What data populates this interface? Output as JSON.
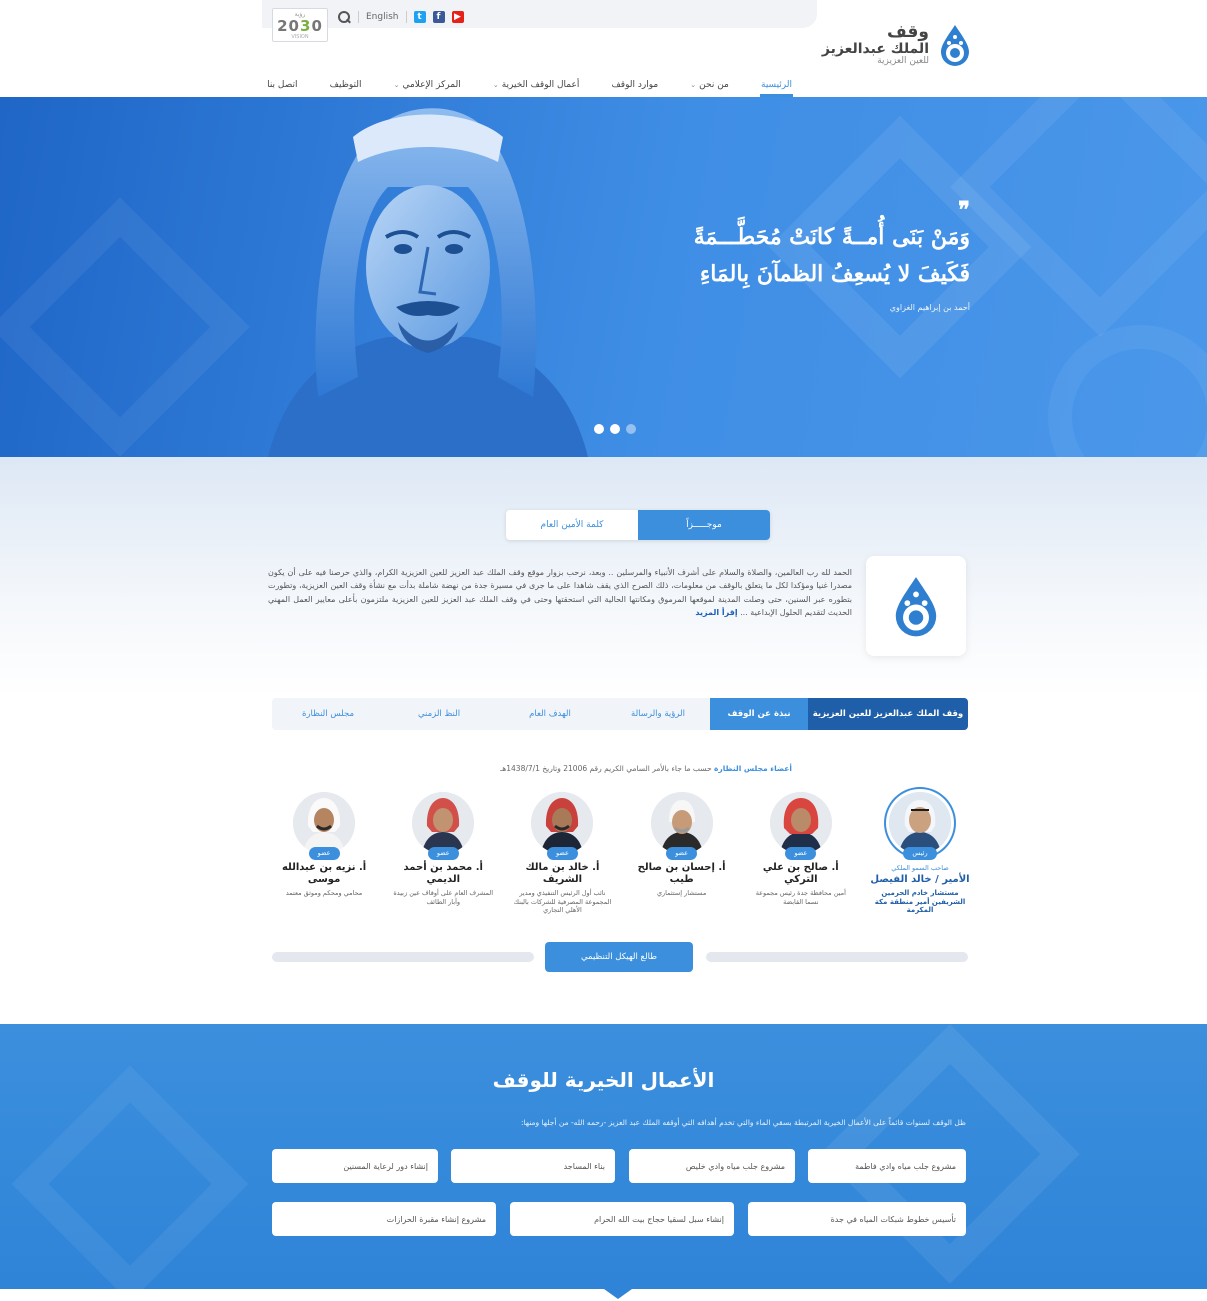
{
  "header": {
    "vision": {
      "top": "رؤية",
      "num_a": "20",
      "num_b": "3",
      "num_c": "0",
      "bottom": "VISION"
    },
    "language": "English",
    "brand": {
      "line1": "وقف",
      "line2": "الملك عبدالعزيز",
      "line3": "للعين العزيزية"
    },
    "nav": [
      {
        "label": "الرئيسية",
        "dropdown": false,
        "active": true
      },
      {
        "label": "من نحن",
        "dropdown": true,
        "active": false
      },
      {
        "label": "موارد الوقف",
        "dropdown": false,
        "active": false
      },
      {
        "label": "أعمال الوقف الخيرية",
        "dropdown": true,
        "active": false
      },
      {
        "label": "المركز الإعلامي",
        "dropdown": true,
        "active": false
      },
      {
        "label": "التوظيف",
        "dropdown": false,
        "active": false
      },
      {
        "label": "اتصل بنا",
        "dropdown": false,
        "active": false
      }
    ]
  },
  "hero": {
    "quote_mark": "❞",
    "line1": "وَمَنْ بَنَى أُمــةً كانَتْ مُحَطَّـــمَةً",
    "line2": "فَكَيفَ لا يُسعِفُ الظمآنَ بِالمَاءِ",
    "author": "أحمد بن إبراهيم الغزاوي",
    "slides": 3,
    "active_slide": 0
  },
  "intro": {
    "toggle": {
      "active": "موجـــــزاً",
      "inactive": "كلمة الأمين العام"
    },
    "text": "الحمد لله رب العالمين، والصلاة والسلام على أشرف الأنبياء والمرسلين .. وبعد، نرحب بزوار موقع وقف الملك عبد العزيز للعين العزيزية الكرام، والذي حرصنا فيه على أن يكون مصدرا غنيا ومؤكدا لكل ما يتعلق بالوقف من معلومات، ذلك الصرح الذي يقف شاهدا على ما جرى في مسيرة جدة من نهضة شاملة بدأت مع نشأة وقف العين العزيزية، وتطورت بتطوره عبر السنين، حتى وصلت المدينة لموقعها المرموق ومكانتها الحالية التي استحقتها وحتى في وقف الملك عبد العزيز للعين العزيزية ملتزمون بأعلى معايير العمل المهني الحديث لتقديم الحلول الإبداعية ...",
    "more": "إقرأ المزيد"
  },
  "tabs": [
    {
      "label": "وقف الملك عبدالعزيز للعين العزيزية",
      "state": "dark"
    },
    {
      "label": "نبذة عن الوقف",
      "state": "on"
    },
    {
      "label": "الرؤية والرسالة",
      "state": "off"
    },
    {
      "label": "الهدف العام",
      "state": "off"
    },
    {
      "label": "النظ الزمني",
      "state": "off"
    },
    {
      "label": "مجلس النظارة",
      "state": "off"
    }
  ],
  "board": {
    "title": "أعضاء مجلس النظارة",
    "note": "حسب ما جاء بالأمر السامي الكريم رقم 21006 وتاريخ 1438/7/1هـ"
  },
  "members": [
    {
      "badge": "رئيس",
      "pre": "صاحب السمو الملكي",
      "name": "الأمير / خالد الفيصل",
      "role": "مستشار خادم الحرمين الشريفين أمير منطقة مكة المكرمة",
      "chair": true
    },
    {
      "badge": "عضو",
      "pre": "",
      "name": "أ. صالح بن علي التركي",
      "role": "أمين محافظة جدة رئيس مجموعة نسما القابضة",
      "chair": false
    },
    {
      "badge": "عضو",
      "pre": "",
      "name": "أ. إحسان بن صالح طيب",
      "role": "مستشار إستثماري",
      "chair": false
    },
    {
      "badge": "عضو",
      "pre": "",
      "name": "أ. خالد بن مالك الشريف",
      "role": "نائب أول الرئيس التنفيذي ومدير المجموعة المصرفية للشركات بالبنك الأهلي التجاري",
      "chair": false
    },
    {
      "badge": "عضو",
      "pre": "",
      "name": "أ. محمد بن أحمد الديمي",
      "role": "المشرف العام على أوقاف عين زبيدة وآبار الطائف",
      "chair": false
    },
    {
      "badge": "عضو",
      "pre": "",
      "name": "أ. نزيه بن عبدالله موسى",
      "role": "محامي ومحكم وموثق معتمد",
      "chair": false
    }
  ],
  "structure_button": "طالع الهيكل التنظيمي",
  "charity": {
    "title": "الأعمال الخيرية للوقف",
    "description": "ظل الوقف لسنوات قائماً على الأعمال الخيرية المرتبطة بسقي الماء والتي تخدم أهدافه التي أوقفه الملك عبد العزيز -رحمه الله- من أجلها ومنها:",
    "row1": [
      "مشروع جلب مياه وادي فاطمة",
      "مشروع جلب مياه وادي خليص",
      "بناء المساجد",
      "إنشاء دور لرعاية المسنين"
    ],
    "row2": [
      "تأسيس خطوط شبكات المياه في جدة",
      "إنشاء سبل لسقيا حجاج بيت الله الحرام",
      "مشروع إنشاء مقبرة الحرازات"
    ]
  },
  "colors": {
    "primary": "#3c8fdd",
    "dark": "#1f5ea8",
    "hero": "#2a74d0"
  }
}
